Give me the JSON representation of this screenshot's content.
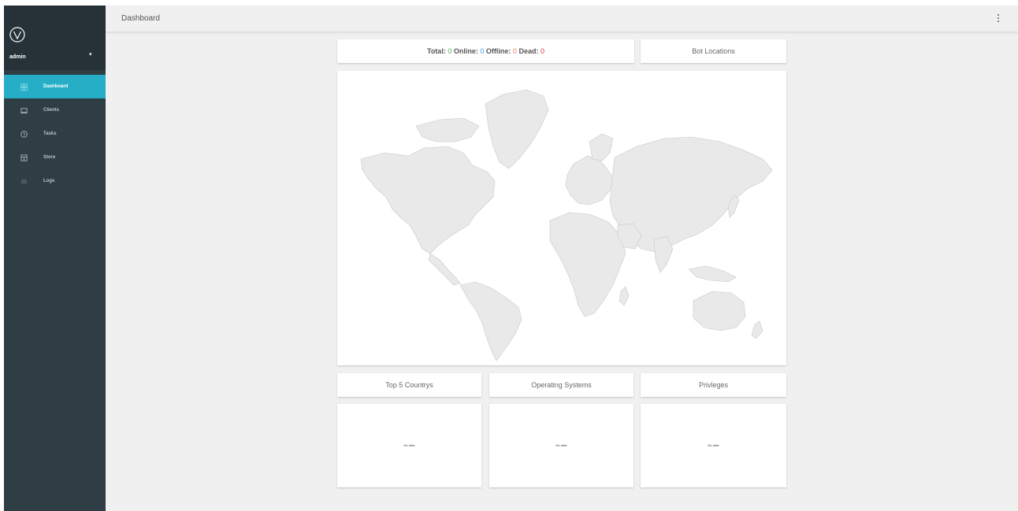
{
  "user": {
    "name": "admin"
  },
  "nav": [
    {
      "label": "Dashboard",
      "icon": "dashboard-icon"
    },
    {
      "label": "Clients",
      "icon": "laptop-icon"
    },
    {
      "label": "Tasks",
      "icon": "clock-icon"
    },
    {
      "label": "Store",
      "icon": "store-icon"
    },
    {
      "label": "Logs",
      "icon": "list-icon"
    }
  ],
  "header": {
    "title": "Dashboard"
  },
  "stats": {
    "total_label": "Total:",
    "total": "0",
    "online_label": "Online:",
    "online": "0",
    "offline_label": "Offline:",
    "offline": "0",
    "dead_label": "Dead:",
    "dead": "0"
  },
  "cards": {
    "bot_locations": "Bot Locations",
    "top_countries": "Top 5 Countrys",
    "operating_systems": "Operating Systems",
    "privileges": "Privleges",
    "no_data": "No data"
  },
  "colors": {
    "sidebar": "#2f3d44",
    "sidebar_header": "#263238",
    "accent": "#26aec6",
    "online": "#3d9be9",
    "offline": "#ef7f62",
    "dead": "#e53935",
    "total": "#4caf50"
  }
}
